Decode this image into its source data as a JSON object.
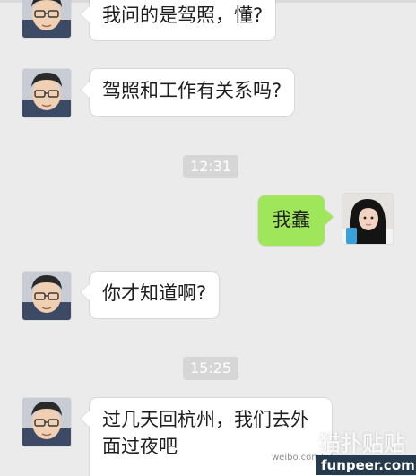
{
  "messages": [
    {
      "side": "left",
      "text": "我问的是驾照，懂?"
    },
    {
      "side": "left",
      "text": "驾照和工作有关系吗?"
    },
    {
      "side": "right",
      "text": "我蠢"
    },
    {
      "side": "left",
      "text": "你才知道啊?"
    },
    {
      "side": "left",
      "text": "过几天回杭州，我们去外面过夜吧"
    }
  ],
  "timestamps": [
    "12:31",
    "15:25"
  ],
  "watermarks": {
    "weibo": "weibo.com/u/...",
    "site": "funpeer.com",
    "brand": "猫扑贴贴"
  },
  "colors": {
    "background": "#ebebeb",
    "bubble_left": "#ffffff",
    "bubble_right": "#9fe65a",
    "timestamp_bg": "#d6d6d6"
  },
  "icons": [
    "contact-avatar",
    "user-avatar",
    "cat-logo-icon"
  ]
}
